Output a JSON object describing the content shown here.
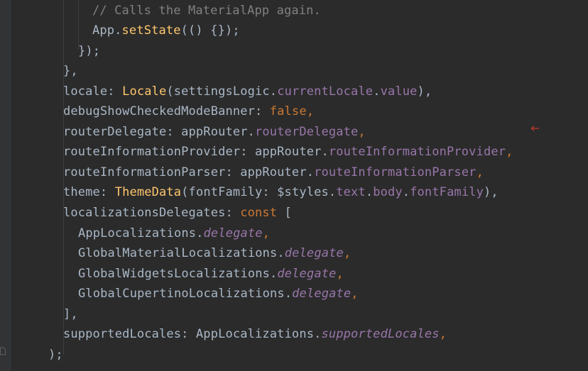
{
  "editor": {
    "lines": [
      {
        "tokens": [
          {
            "t": "// Calls the MaterialApp again.",
            "k": "comment"
          }
        ]
      },
      {
        "tokens": [
          {
            "t": "App.",
            "k": "plain"
          },
          {
            "t": "setState",
            "k": "method"
          },
          {
            "t": "(() {});",
            "k": "plain"
          }
        ]
      },
      {
        "tokens": [
          {
            "t": "});",
            "k": "plain"
          }
        ]
      },
      {
        "tokens": [
          {
            "t": "},",
            "k": "plain"
          }
        ]
      },
      {
        "tokens": [
          {
            "t": "locale: ",
            "k": "plain"
          },
          {
            "t": "Locale",
            "k": "class"
          },
          {
            "t": "(settingsLogic.",
            "k": "plain"
          },
          {
            "t": "currentLocale",
            "k": "field"
          },
          {
            "t": ".",
            "k": "plain"
          },
          {
            "t": "value",
            "k": "field"
          },
          {
            "t": "),",
            "k": "plain"
          }
        ]
      },
      {
        "tokens": [
          {
            "t": "debugShowCheckedModeBanner: ",
            "k": "plain"
          },
          {
            "t": "false",
            "k": "keyword"
          },
          {
            "t": ",",
            "k": "keyword"
          }
        ]
      },
      {
        "tokens": [
          {
            "t": "routerDelegate: appRouter.",
            "k": "plain"
          },
          {
            "t": "routerDelegate",
            "k": "field"
          },
          {
            "t": ",",
            "k": "keyword"
          }
        ]
      },
      {
        "tokens": [
          {
            "t": "routeInformationProvider: appRouter.",
            "k": "plain"
          },
          {
            "t": "routeInformationProvider",
            "k": "field"
          },
          {
            "t": ",",
            "k": "keyword"
          }
        ]
      },
      {
        "tokens": [
          {
            "t": "routeInformationParser: appRouter.",
            "k": "plain"
          },
          {
            "t": "routeInformationParser",
            "k": "field"
          },
          {
            "t": ",",
            "k": "keyword"
          }
        ]
      },
      {
        "tokens": [
          {
            "t": "theme: ",
            "k": "plain"
          },
          {
            "t": "ThemeData",
            "k": "class"
          },
          {
            "t": "(fontFamily: $styles.",
            "k": "plain"
          },
          {
            "t": "text",
            "k": "field"
          },
          {
            "t": ".",
            "k": "plain"
          },
          {
            "t": "body",
            "k": "field"
          },
          {
            "t": ".",
            "k": "plain"
          },
          {
            "t": "fontFamily",
            "k": "field"
          },
          {
            "t": "),",
            "k": "plain"
          }
        ]
      },
      {
        "tokens": [
          {
            "t": "localizationsDelegates: ",
            "k": "plain"
          },
          {
            "t": "const",
            "k": "keyword"
          },
          {
            "t": " [",
            "k": "plain"
          }
        ]
      },
      {
        "tokens": [
          {
            "t": "AppLocalizations.",
            "k": "plain"
          },
          {
            "t": "delegate",
            "k": "static"
          },
          {
            "t": ",",
            "k": "keyword"
          }
        ]
      },
      {
        "tokens": [
          {
            "t": "GlobalMaterialLocalizations.",
            "k": "plain"
          },
          {
            "t": "delegate",
            "k": "static"
          },
          {
            "t": ",",
            "k": "keyword"
          }
        ]
      },
      {
        "tokens": [
          {
            "t": "GlobalWidgetsLocalizations.",
            "k": "plain"
          },
          {
            "t": "delegate",
            "k": "static"
          },
          {
            "t": ",",
            "k": "keyword"
          }
        ]
      },
      {
        "tokens": [
          {
            "t": "GlobalCupertinoLocalizations.",
            "k": "plain"
          },
          {
            "t": "delegate",
            "k": "static"
          },
          {
            "t": ",",
            "k": "keyword"
          }
        ]
      },
      {
        "tokens": [
          {
            "t": "],",
            "k": "plain"
          }
        ]
      },
      {
        "tokens": [
          {
            "t": "supportedLocales: AppLocalizations.",
            "k": "plain"
          },
          {
            "t": "supportedLocales",
            "k": "static"
          },
          {
            "t": ",",
            "k": "keyword"
          }
        ]
      },
      {
        "tokens": [
          {
            "t": ");",
            "k": "plain"
          }
        ]
      }
    ]
  },
  "icons": {
    "marker": "left-arrow-marker-icon",
    "fold": "fold-icon"
  },
  "colors": {
    "background": "#2b2b2b",
    "plain": "#a9b7c6",
    "comment": "#808080",
    "method": "#ffc66d",
    "keyword": "#cc7832",
    "field": "#9876aa",
    "marker": "#c0392b"
  }
}
